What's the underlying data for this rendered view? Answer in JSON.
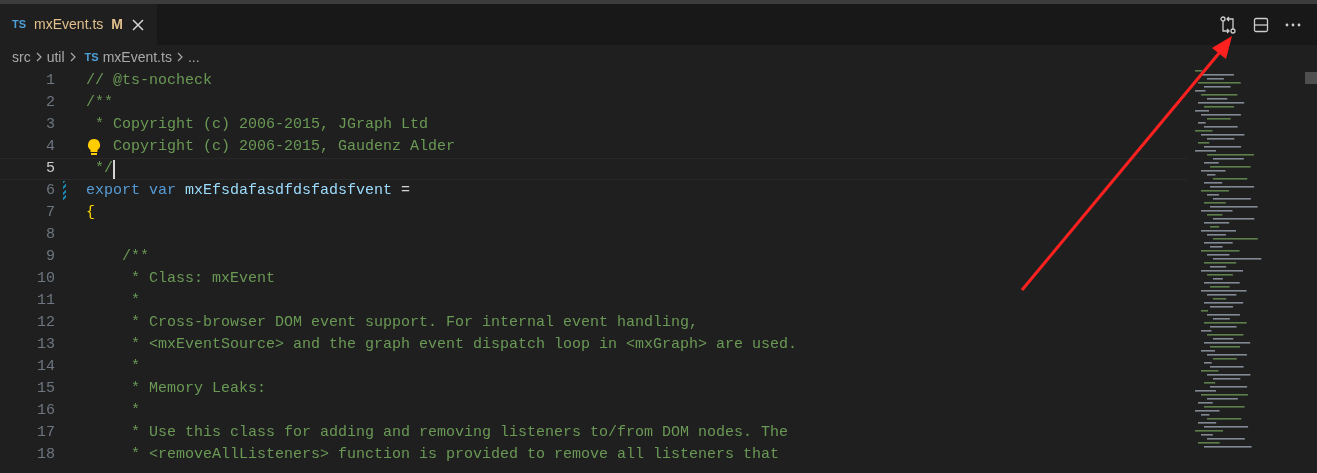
{
  "tabs": [
    {
      "badge": "TS",
      "label": "mxEvent.ts",
      "status": "M",
      "selected": true
    }
  ],
  "breadcrumbs": [
    {
      "label": "src"
    },
    {
      "label": "util"
    },
    {
      "label": "mxEvent.ts",
      "badge": "TS"
    },
    {
      "label": "..."
    }
  ],
  "editor": {
    "lines": [
      {
        "number": "1",
        "tokens": [
          {
            "kind": "comment",
            "text": "// @ts-nocheck"
          }
        ]
      },
      {
        "number": "2",
        "tokens": [
          {
            "kind": "comment",
            "text": "/**"
          }
        ]
      },
      {
        "number": "3",
        "tokens": [
          {
            "kind": "comment",
            "text": " * Copyright (c) 2006-2015, JGraph Ltd"
          }
        ]
      },
      {
        "number": "4",
        "lightbulb": true,
        "tokens": [
          {
            "kind": "comment",
            "text": "Copyright (c) 2006-2015, Gaudenz Alder"
          }
        ]
      },
      {
        "number": "5",
        "current": true,
        "tokens": [
          {
            "kind": "comment",
            "text": " */"
          }
        ]
      },
      {
        "number": "6",
        "modified": true,
        "tokens": [
          {
            "kind": "keyword",
            "text": "export "
          },
          {
            "kind": "keyword",
            "text": "var "
          },
          {
            "kind": "variable",
            "text": "mxEfsdafasdfdsfadsfvent"
          },
          {
            "kind": "plain",
            "text": " ="
          }
        ]
      },
      {
        "number": "7",
        "tokens": [
          {
            "kind": "brace",
            "text": "{"
          }
        ]
      },
      {
        "number": "8"
      },
      {
        "number": "9",
        "tokens": [
          {
            "kind": "comment",
            "text": "    /**"
          }
        ]
      },
      {
        "number": "10",
        "tokens": [
          {
            "kind": "comment",
            "text": "     * Class: mxEvent"
          }
        ]
      },
      {
        "number": "11",
        "tokens": [
          {
            "kind": "comment",
            "text": "     *"
          }
        ]
      },
      {
        "number": "12",
        "tokens": [
          {
            "kind": "comment",
            "text": "     * Cross-browser DOM event support. For internal event handling,"
          }
        ]
      },
      {
        "number": "13",
        "tokens": [
          {
            "kind": "comment",
            "text": "     * <mxEventSource> and the graph event dispatch loop in <mxGraph> are used."
          }
        ]
      },
      {
        "number": "14",
        "tokens": [
          {
            "kind": "comment",
            "text": "     *"
          }
        ]
      },
      {
        "number": "15",
        "tokens": [
          {
            "kind": "comment",
            "text": "     * Memory Leaks:"
          }
        ]
      },
      {
        "number": "16",
        "tokens": [
          {
            "kind": "comment",
            "text": "     *"
          }
        ]
      },
      {
        "number": "17",
        "tokens": [
          {
            "kind": "comment",
            "text": "     * Use this class for adding and removing listeners to/from DOM nodes. The"
          }
        ]
      },
      {
        "number": "18",
        "tokens": [
          {
            "kind": "comment",
            "text": "     * <removeAllListeners> function is provided to remove all listeners that"
          }
        ]
      }
    ]
  }
}
